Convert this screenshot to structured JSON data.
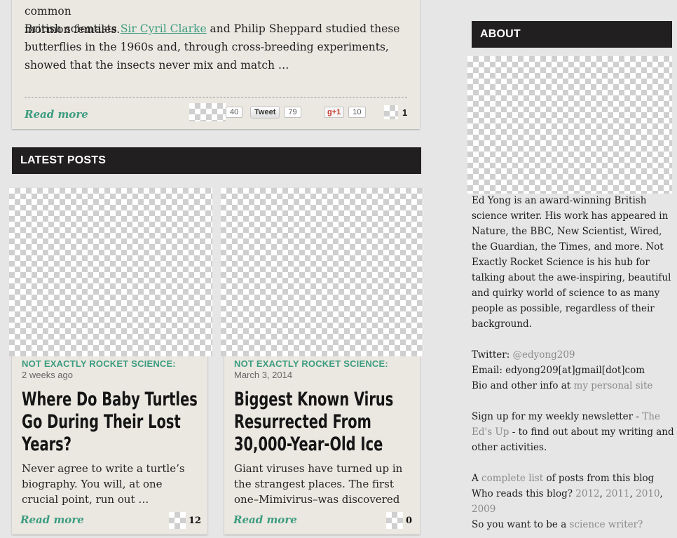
{
  "top_article": {
    "para1_line1": "halves are an different butterfly species, and the left halves are an common",
    "para1_line2": "mormon females.",
    "para2_pre": "British scientists ",
    "para2_link": "Sir Cyril Clarke",
    "para2_post": " and Philip Sheppard studied these butterflies in the 1960s and, through cross-breeding experiments, showed that the insects never mix and match …",
    "read_more": "Read more",
    "share": {
      "like_count": "40",
      "tweet_label": "Tweet",
      "tweet_count": "79",
      "gplus_label": "g+1",
      "gplus_count": "10",
      "other_count": "1"
    }
  },
  "latest_posts": {
    "header": "LATEST POSTS",
    "posts": [
      {
        "category": "NOT EXACTLY ROCKET SCIENCE:",
        "date": "2 weeks ago",
        "title": "Where Do Baby Turtles Go During Their Lost Years?",
        "excerpt": "Never agree to write a turtle’s biography. You will, at one crucial point, run out …",
        "read_more": "Read more",
        "share_count": "12"
      },
      {
        "category": "NOT EXACTLY ROCKET SCIENCE:",
        "date": "March 3, 2014",
        "title": "Biggest Known Virus Resurrected From 30,000-Year-Old Ice",
        "excerpt": "Giant viruses have turned up in the strangest places. The first one–Mimivirus–was discovered",
        "read_more": "Read more",
        "share_count": "0"
      }
    ]
  },
  "about": {
    "header": "ABOUT",
    "bio": "Ed Yong is an award-winning British science writer. His work has appeared in Nature, the BBC, New Scientist, Wired, the Guardian, the Times, and more. Not Exactly Rocket Science is his hub for talking about the awe-inspiring, beautiful and quirky world of science to as many people as possible, regardless of their background.",
    "twitter_label": "Twitter: ",
    "twitter_handle": "@edyong209",
    "email_line": "Email: edyong209[at]gmail[dot]com",
    "bio_info_label": "Bio and other info at ",
    "bio_info_link": "my personal site",
    "newsletter_pre": "Sign up for my weekly newsletter - ",
    "newsletter_link": "The Ed's Up",
    "newsletter_post": " - to find out about my writing and other activities.",
    "list_pre": "A ",
    "list_link": "complete list",
    "list_post": " of posts from this blog",
    "readers_label": "Who reads this blog? ",
    "readers_years": [
      "2012",
      "2011",
      "2010",
      "2009"
    ],
    "writer_pre": "So you want to be a ",
    "writer_link": "science writer?"
  },
  "colors": {
    "accent": "#3c9c80",
    "header_bg": "#221f20",
    "card_bg": "#ebe8e1",
    "page_bg": "#e6e6e6"
  }
}
